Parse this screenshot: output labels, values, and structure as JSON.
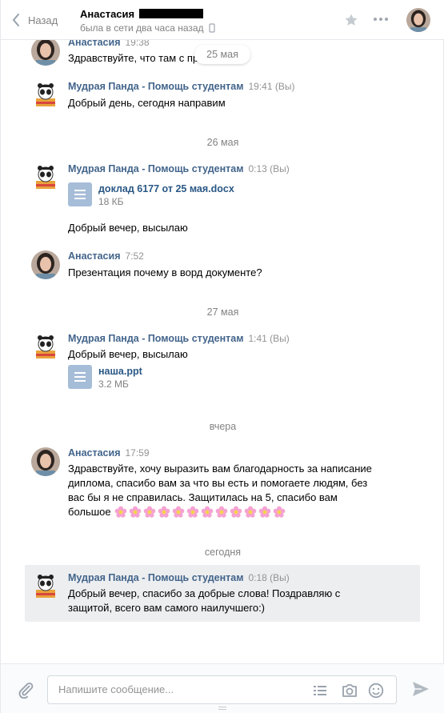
{
  "header": {
    "back_label": "Назад",
    "contact_name": "Анастасия",
    "status": "была в сети два часа назад"
  },
  "floating_date": "25 мая",
  "messages": [
    {
      "author": "Анастасия",
      "time": "19:38",
      "text": "Здравствуйте, что там с пр              й"
    },
    {
      "author": "Мудрая Панда - Помощь студентам",
      "time": "19:41 (Вы)",
      "text": "Добрый день, сегодня направим"
    },
    {
      "date": "26 мая"
    },
    {
      "author": "Мудрая Панда - Помощь студентам",
      "time": "0:13 (Вы)",
      "attachment": {
        "name": "доклад 6177 от 25 мая.docx",
        "size": "18 КБ"
      },
      "text": "Добрый вечер, высылаю"
    },
    {
      "author": "Анастасия",
      "time": "7:52",
      "text": "Презентация почему в ворд документе?"
    },
    {
      "date": "27 мая"
    },
    {
      "author": "Мудрая Панда - Помощь студентам",
      "time": "1:41 (Вы)",
      "text": "Добрый вечер, высылаю",
      "attachment": {
        "name": "наша.ppt",
        "size": "3.2 МБ"
      }
    },
    {
      "date": "вчера"
    },
    {
      "author": "Анастасия",
      "time": "17:59",
      "lines": [
        "Здравствуйте, хочу выразить вам благодарность за написание",
        "диплома, спасибо вам за что вы есть и помогаете людям, без",
        "вас бы я не справилась. Защитилась на 5, спасибо вам",
        "большое"
      ],
      "emoji_count": 12
    },
    {
      "date": "сегодня"
    },
    {
      "author": "Мудрая Панда - Помощь студентам",
      "time": "0:18 (Вы)",
      "lines": [
        "Добрый вечер, спасибо за добрые слова! Поздравляю с",
        "защитой, всего вам самого наилучшего:)"
      ]
    }
  ],
  "composer": {
    "placeholder": "Напишите сообщение..."
  },
  "colors": {
    "link": "#42648b",
    "accent": "#5181b8",
    "highlight": "#edeef0",
    "flower": "#f5a3d1"
  },
  "icons": [
    "chevron-left-icon",
    "phone-icon",
    "star-icon",
    "more-icon",
    "paperclip-icon",
    "list-icon",
    "camera-icon",
    "smile-icon",
    "send-icon",
    "document-icon",
    "flower-icon"
  ]
}
